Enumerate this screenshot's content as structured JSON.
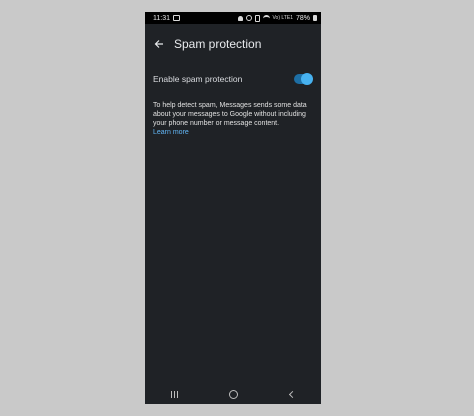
{
  "status_bar": {
    "time": "11:31",
    "signal": "Vo) LTE1",
    "battery": "78%"
  },
  "app_bar": {
    "title": "Spam protection"
  },
  "setting": {
    "label": "Enable spam protection",
    "enabled": true
  },
  "description": {
    "text": "To help detect spam, Messages sends some data about your messages to Google without including your phone number or message content.",
    "link": "Learn more"
  },
  "colors": {
    "background": "#1f2226",
    "accent": "#47b2f0",
    "link": "#62b6f5"
  },
  "icons": [
    "gallery-icon",
    "bell-icon",
    "alarm-icon",
    "vibrate-icon",
    "wifi-icon",
    "battery-icon",
    "back-arrow-icon",
    "recents-icon",
    "home-icon",
    "back-icon"
  ]
}
